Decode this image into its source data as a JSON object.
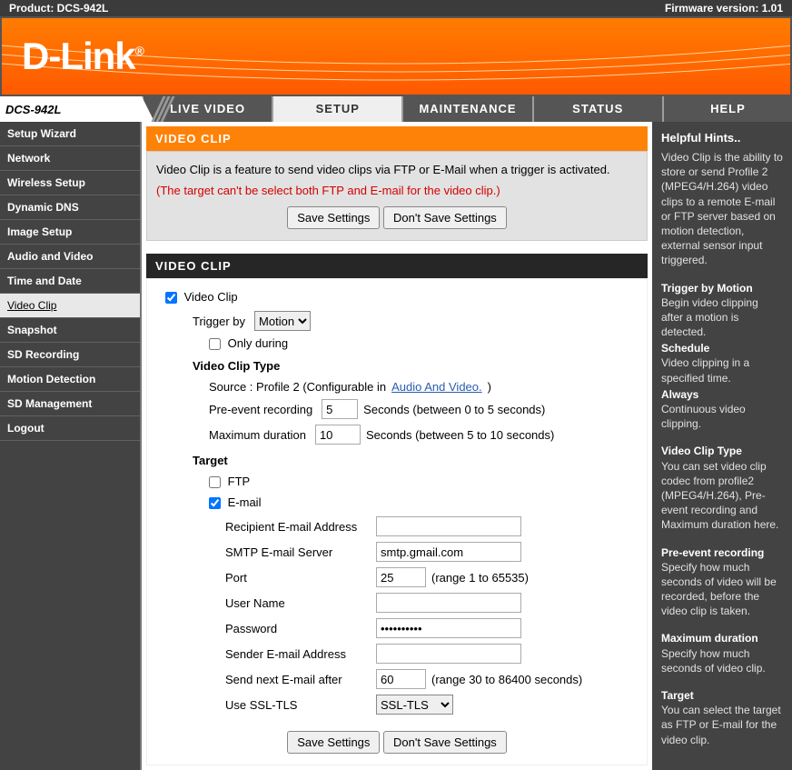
{
  "topbar": {
    "product_label": "Product: DCS-942L",
    "firmware_label": "Firmware version: 1.01"
  },
  "model": "DCS-942L",
  "tabs": {
    "live_video": "LIVE VIDEO",
    "setup": "SETUP",
    "maintenance": "MAINTENANCE",
    "status": "STATUS",
    "help": "HELP"
  },
  "sidebar": {
    "items": [
      "Setup Wizard",
      "Network",
      "Wireless Setup",
      "Dynamic DNS",
      "Image Setup",
      "Audio and Video",
      "Time and Date",
      "Video Clip",
      "Snapshot",
      "SD Recording",
      "Motion Detection",
      "SD Management",
      "Logout"
    ],
    "active_index": 7
  },
  "header": "VIDEO CLIP",
  "intro": {
    "text": "Video Clip is a feature to send video clips via FTP or E-Mail when a trigger is activated.",
    "warning": "(The target can't be select both FTP and E-mail for the video clip.)"
  },
  "buttons": {
    "save": "Save Settings",
    "dont_save": "Don't Save Settings"
  },
  "section_title": "VIDEO CLIP",
  "form": {
    "video_clip_label": "Video Clip",
    "trigger_by_label": "Trigger by",
    "trigger_by_value": "Motion",
    "only_during_label": "Only during",
    "vct_label": "Video Clip Type",
    "source_text": "Source : Profile 2  (Configurable in ",
    "source_link": "Audio And Video.",
    "source_close": ")",
    "pre_event_label": "Pre-event recording",
    "pre_event_value": "5",
    "pre_event_suffix": "Seconds  (between 0 to 5 seconds)",
    "max_dur_label": "Maximum duration",
    "max_dur_value": "10",
    "max_dur_suffix": "Seconds  (between 5 to 10 seconds)",
    "target_label": "Target",
    "ftp_label": "FTP",
    "email_label": "E-mail",
    "email": {
      "recipient_label": "Recipient E-mail Address",
      "recipient_value": "",
      "smtp_label": "SMTP E-mail Server",
      "smtp_value": "smtp.gmail.com",
      "port_label": "Port",
      "port_value": "25",
      "port_range": "(range 1 to 65535)",
      "user_label": "User Name",
      "user_value": "",
      "pass_label": "Password",
      "pass_value": "••••••••••",
      "sender_label": "Sender E-mail Address",
      "sender_value": "",
      "next_label": "Send next E-mail after",
      "next_value": "60",
      "next_range": "(range 30 to 86400 seconds)",
      "ssl_label": "Use SSL-TLS",
      "ssl_value": "SSL-TLS"
    }
  },
  "hints": {
    "title": "Helpful Hints..",
    "p1": "Video Clip is the ability to store or send Profile 2 (MPEG4/H.264) video clips to a remote E-mail or FTP server based on motion detection, external sensor input triggered.",
    "h_motion": "Trigger by Motion",
    "p_motion": "Begin video clipping after a motion is detected.",
    "h_sched": "Schedule",
    "p_sched": "Video clipping in a specified time.",
    "h_always": "Always",
    "p_always": "Continuous video clipping.",
    "h_type": "Video Clip Type",
    "p_type": "You can set video clip codec from profile2 (MPEG4/H.264), Pre-event recording and Maximum duration here.",
    "h_pre": "Pre-event recording",
    "p_pre": "Specify how much seconds of video will be recorded, before the video clip is taken.",
    "h_max": "Maximum duration",
    "p_max": "Specify how much seconds of video clip.",
    "h_target": "Target",
    "p_target": "You can select the target as FTP or E-mail for the video clip."
  }
}
